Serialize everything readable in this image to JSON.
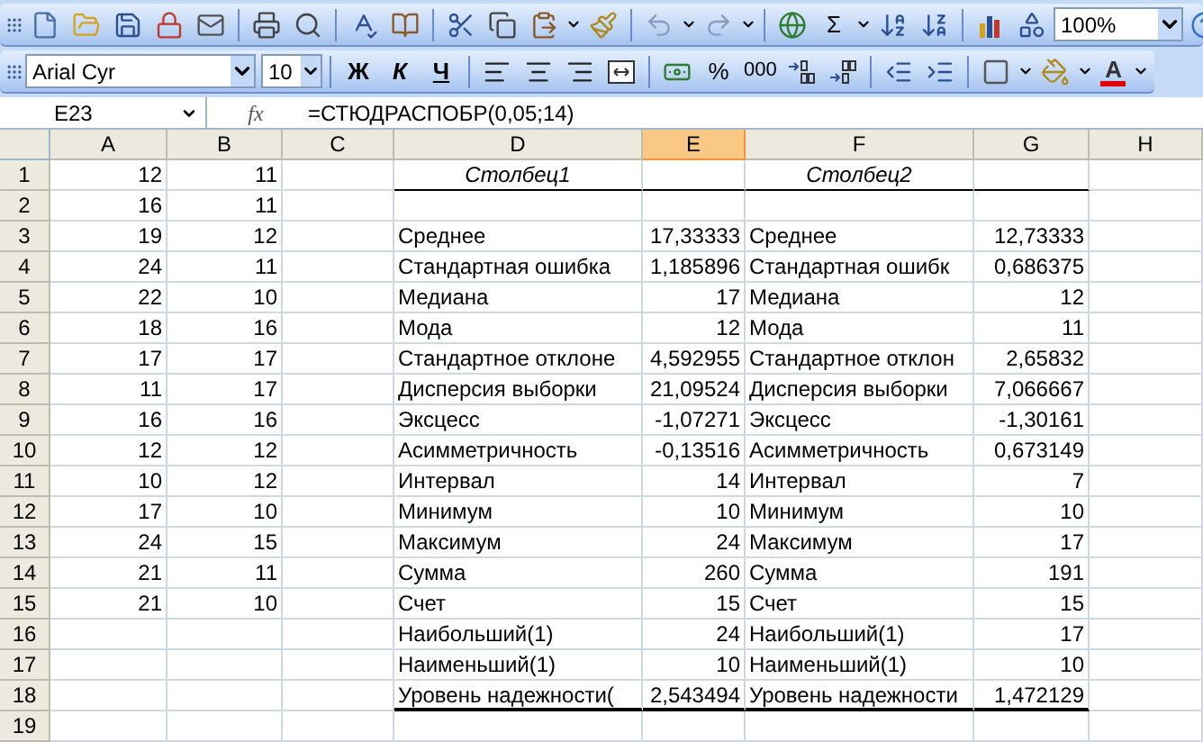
{
  "standard_toolbar": {
    "autosum": "Σ",
    "zoom": "100%"
  },
  "formatting_toolbar": {
    "font": "Arial Cyr",
    "size": "10",
    "bold": "Ж",
    "italic": "К",
    "underline": "Ч",
    "percent": "%",
    "thousands": "000",
    "font_color": "A"
  },
  "formula_bar": {
    "name_box": "E23",
    "fx": "fx",
    "formula": "=СТЮДРАСПОБР(0,05;14)"
  },
  "columns": [
    {
      "label": "A",
      "selected": false
    },
    {
      "label": "B",
      "selected": false
    },
    {
      "label": "C",
      "selected": false
    },
    {
      "label": "D",
      "selected": false
    },
    {
      "label": "E",
      "selected": true
    },
    {
      "label": "F",
      "selected": false
    },
    {
      "label": "G",
      "selected": false
    },
    {
      "label": "H",
      "selected": false
    }
  ],
  "rows": [
    {
      "number": "1",
      "kind": "heading",
      "a": "12",
      "b": "11",
      "d": "Столбец1",
      "f": "Столбец2"
    },
    {
      "number": "2",
      "kind": "data",
      "a": "16",
      "b": "11"
    },
    {
      "number": "3",
      "kind": "data",
      "a": "19",
      "b": "12",
      "d": "Среднее",
      "e": "17,33333",
      "f": "Среднее",
      "g": "12,73333"
    },
    {
      "number": "4",
      "kind": "data",
      "a": "24",
      "b": "11",
      "d": "Стандартная ошибка",
      "e": "1,185896",
      "f": "Стандартная ошибк",
      "g": "0,686375"
    },
    {
      "number": "5",
      "kind": "data",
      "a": "22",
      "b": "10",
      "d": "Медиана",
      "e": "17",
      "f": "Медиана",
      "g": "12"
    },
    {
      "number": "6",
      "kind": "data",
      "a": "18",
      "b": "16",
      "d": "Мода",
      "e": "12",
      "f": "Мода",
      "g": "11"
    },
    {
      "number": "7",
      "kind": "data",
      "a": "17",
      "b": "17",
      "d": "Стандартное отклоне",
      "e": "4,592955",
      "f": "Стандартное отклон",
      "g": "2,65832"
    },
    {
      "number": "8",
      "kind": "data",
      "a": "11",
      "b": "17",
      "d": "Дисперсия выборки",
      "e": "21,09524",
      "f": "Дисперсия выборки",
      "g": "7,066667"
    },
    {
      "number": "9",
      "kind": "data",
      "a": "16",
      "b": "16",
      "d": "Эксцесс",
      "e": "-1,07271",
      "f": "Эксцесс",
      "g": "-1,30161"
    },
    {
      "number": "10",
      "kind": "data",
      "a": "12",
      "b": "12",
      "d": "Асимметричность",
      "e": "-0,13516",
      "f": "Асимметричность",
      "g": "0,673149"
    },
    {
      "number": "11",
      "kind": "data",
      "a": "10",
      "b": "12",
      "d": "Интервал",
      "e": "14",
      "f": "Интервал",
      "g": "7"
    },
    {
      "number": "12",
      "kind": "data",
      "a": "17",
      "b": "10",
      "d": "Минимум",
      "e": "10",
      "f": "Минимум",
      "g": "10"
    },
    {
      "number": "13",
      "kind": "data",
      "a": "24",
      "b": "15",
      "d": "Максимум",
      "e": "24",
      "f": "Максимум",
      "g": "17"
    },
    {
      "number": "14",
      "kind": "data",
      "a": "21",
      "b": "11",
      "d": "Сумма",
      "e": "260",
      "f": "Сумма",
      "g": "191"
    },
    {
      "number": "15",
      "kind": "data",
      "a": "21",
      "b": "10",
      "d": "Счет",
      "e": "15",
      "f": "Счет",
      "g": "15"
    },
    {
      "number": "16",
      "kind": "data",
      "d": "Наибольший(1)",
      "e": "24",
      "f": "Наибольший(1)",
      "g": "17"
    },
    {
      "number": "17",
      "kind": "data",
      "d": "Наименьший(1)",
      "e": "10",
      "f": "Наименьший(1)",
      "g": "10"
    },
    {
      "number": "18",
      "kind": "closing",
      "d": "Уровень надежности(",
      "e": "2,543494",
      "f": "Уровень надежности",
      "g": "1,472129"
    },
    {
      "number": "19",
      "kind": "data"
    }
  ]
}
